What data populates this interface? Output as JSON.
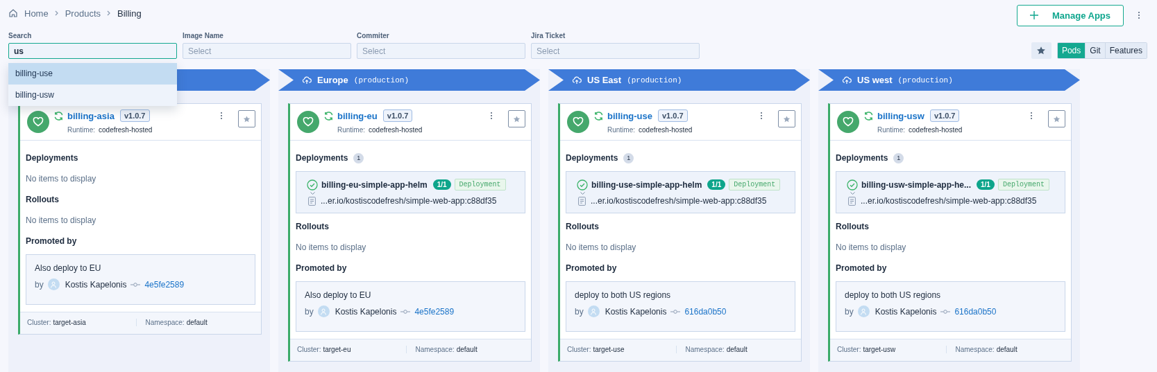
{
  "breadcrumbs": [
    {
      "label": "Home",
      "kind": "home"
    },
    {
      "label": "Products",
      "kind": "link"
    },
    {
      "label": "Billing",
      "kind": "current"
    }
  ],
  "header": {
    "manage_button": "Manage Apps"
  },
  "filters": [
    {
      "label": "Search",
      "value": "us",
      "focused": true
    },
    {
      "label": "Image Name",
      "placeholder": "Select",
      "focused": false
    },
    {
      "label": "Commiter",
      "placeholder": "Select",
      "focused": false
    },
    {
      "label": "Jira Ticket",
      "placeholder": "Select",
      "focused": false
    }
  ],
  "search_suggestions": [
    {
      "label": "billing-use",
      "selected": true
    },
    {
      "label": "billing-usw",
      "selected": false
    }
  ],
  "view_tabs": [
    {
      "label": "Pods",
      "selected": true
    },
    {
      "label": "Git",
      "selected": false
    },
    {
      "label": "Features",
      "selected": false
    }
  ],
  "environments": [
    {
      "card": {
        "app": "billing-asia",
        "version": "v1.0.7",
        "healthy": true,
        "runtime_label": "Runtime:",
        "runtime": "codefresh-hosted",
        "deployments": {
          "title": "Deployments",
          "empty": "No items to display"
        },
        "rollouts": {
          "title": "Rollouts",
          "empty": "No items to display"
        },
        "promoted": {
          "title": "Promoted by",
          "message": "Also deploy to EU",
          "by": "by",
          "author": "Kostis Kapelonis",
          "commit": "4e5fe2589"
        },
        "cluster_label": "Cluster:",
        "cluster": "target-asia",
        "namespace_label": "Namespace:",
        "namespace": "default"
      }
    },
    {
      "name": "Europe",
      "tag": "(production)",
      "card": {
        "app": "billing-eu",
        "version": "v1.0.7",
        "healthy": true,
        "runtime_label": "Runtime:",
        "runtime": "codefresh-hosted",
        "deployments": {
          "title": "Deployments",
          "count": "1",
          "items": [
            {
              "name": "billing-eu-simple-app-helm",
              "replicas": "1/1",
              "kind_tag": "Deployment",
              "image": "...er.io/kostiscodefresh/simple-web-app:c88df35"
            }
          ]
        },
        "rollouts": {
          "title": "Rollouts",
          "empty": "No items to display"
        },
        "promoted": {
          "title": "Promoted by",
          "message": "Also deploy to EU",
          "by": "by",
          "author": "Kostis Kapelonis",
          "commit": "4e5fe2589"
        },
        "cluster_label": "Cluster:",
        "cluster": "target-eu",
        "namespace_label": "Namespace:",
        "namespace": "default"
      }
    },
    {
      "name": "US East",
      "tag": "(production)",
      "card": {
        "app": "billing-use",
        "version": "v1.0.7",
        "healthy": true,
        "runtime_label": "Runtime:",
        "runtime": "codefresh-hosted",
        "deployments": {
          "title": "Deployments",
          "count": "1",
          "items": [
            {
              "name": "billing-use-simple-app-helm",
              "replicas": "1/1",
              "kind_tag": "Deployment",
              "image": "...er.io/kostiscodefresh/simple-web-app:c88df35"
            }
          ]
        },
        "rollouts": {
          "title": "Rollouts",
          "empty": "No items to display"
        },
        "promoted": {
          "title": "Promoted by",
          "message": "deploy to both US regions",
          "by": "by",
          "author": "Kostis Kapelonis",
          "commit": "616da0b50"
        },
        "cluster_label": "Cluster:",
        "cluster": "target-use",
        "namespace_label": "Namespace:",
        "namespace": "default"
      }
    },
    {
      "name": "US west",
      "tag": "(production)",
      "card": {
        "app": "billing-usw",
        "version": "v1.0.7",
        "healthy": true,
        "runtime_label": "Runtime:",
        "runtime": "codefresh-hosted",
        "deployments": {
          "title": "Deployments",
          "count": "1",
          "items": [
            {
              "name": "billing-usw-simple-app-he...",
              "replicas": "1/1",
              "kind_tag": "Deployment",
              "image": "...er.io/kostiscodefresh/simple-web-app:c88df35"
            }
          ]
        },
        "rollouts": {
          "title": "Rollouts",
          "empty": "No items to display"
        },
        "promoted": {
          "title": "Promoted by",
          "message": "deploy to both US regions",
          "by": "by",
          "author": "Kostis Kapelonis",
          "commit": "616da0b50"
        },
        "cluster_label": "Cluster:",
        "cluster": "target-usw",
        "namespace_label": "Namespace:",
        "namespace": "default"
      }
    }
  ]
}
